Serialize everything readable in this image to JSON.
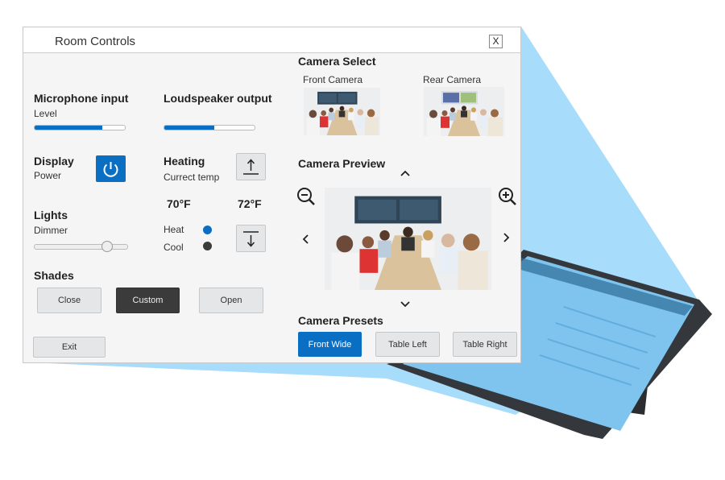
{
  "window": {
    "title": "Room Controls",
    "close_label": "X"
  },
  "microphone": {
    "heading": "Microphone input",
    "sublabel": "Level",
    "level_percent": 75
  },
  "loudspeaker": {
    "heading": "Loudspeaker output",
    "level_percent": 55
  },
  "display": {
    "heading": "Display",
    "sublabel": "Power",
    "icon": "power-icon"
  },
  "heating": {
    "heading": "Heating",
    "sublabel": "Currect temp",
    "current_temp": "70°F",
    "set_temp": "72°F",
    "heat_label": "Heat",
    "cool_label": "Cool",
    "heat_active": true,
    "up_icon": "arrow-up-icon",
    "down_icon": "arrow-down-icon"
  },
  "lights": {
    "heading": "Lights",
    "sublabel": "Dimmer",
    "dimmer_percent": 77
  },
  "shades": {
    "heading": "Shades",
    "buttons": [
      "Close",
      "Custom",
      "Open"
    ],
    "selected": "Custom"
  },
  "exit_label": "Exit",
  "camera_select": {
    "heading": "Camera Select",
    "cameras": [
      "Front Camera",
      "Rear Camera"
    ]
  },
  "camera_preview": {
    "heading": "Camera Preview"
  },
  "camera_presets": {
    "heading": "Camera Presets",
    "buttons": [
      "Front Wide",
      "Table Left",
      "Table Right"
    ],
    "selected": "Front Wide"
  },
  "colors": {
    "accent": "#0a6fc2",
    "dark_button": "#3b3b3b",
    "beam": "#a8dcfb",
    "panel_bg": "#f6f5f6"
  }
}
